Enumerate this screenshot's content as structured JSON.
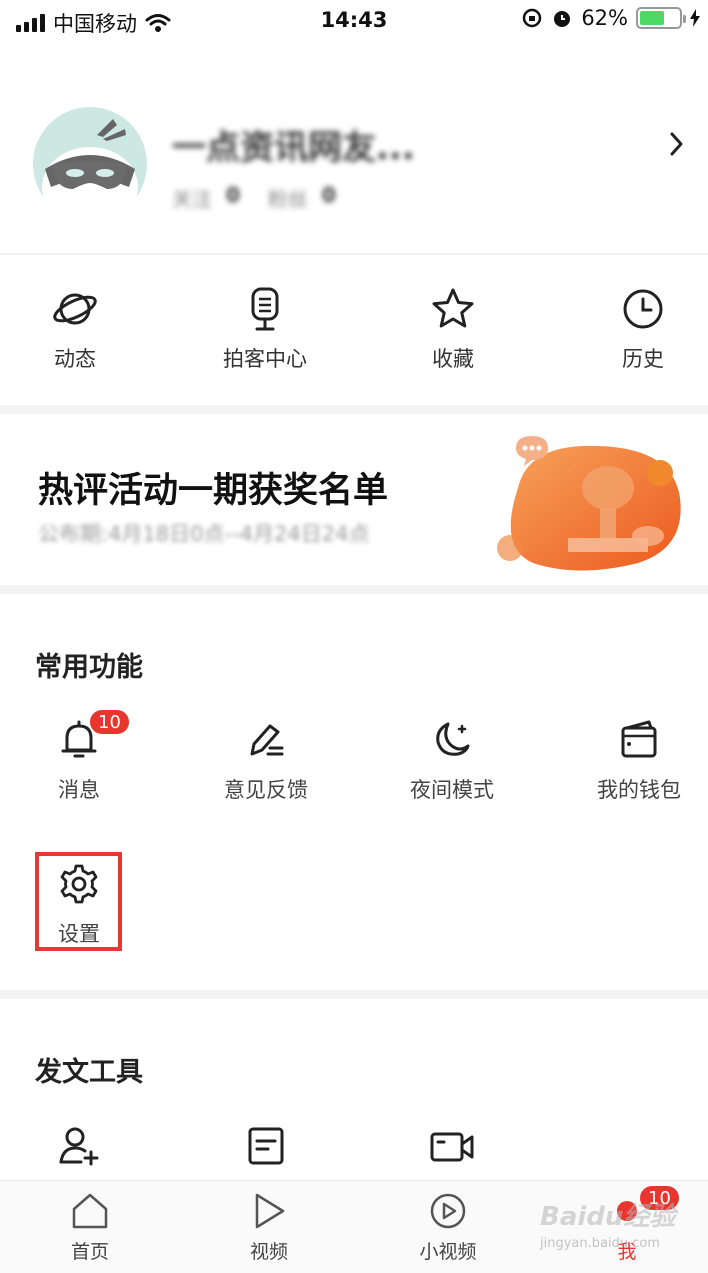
{
  "status_bar": {
    "carrier": "中国移动",
    "time": "14:43",
    "battery": "62%",
    "battery_level": 0.62
  },
  "profile": {
    "name": "一点资讯网友...",
    "following_label": "关注",
    "following_count": "0",
    "fans_label": "粉丝",
    "fans_count": "0"
  },
  "quick_actions": [
    {
      "label": "动态",
      "icon": "planet-icon"
    },
    {
      "label": "拍客中心",
      "icon": "microphone-icon"
    },
    {
      "label": "收藏",
      "icon": "star-icon"
    },
    {
      "label": "历史",
      "icon": "clock-icon"
    }
  ],
  "banner": {
    "title": "热评活动一期获奖名单",
    "subtitle": "公布期:4月18日0点--4月24日24点",
    "accent_color": "#f26b2e"
  },
  "common_functions": {
    "title": "常用功能",
    "items": [
      {
        "label": "消息",
        "icon": "bell-icon",
        "badge": "10"
      },
      {
        "label": "意见反馈",
        "icon": "pencil-icon"
      },
      {
        "label": "夜间模式",
        "icon": "moon-icon"
      },
      {
        "label": "我的钱包",
        "icon": "wallet-icon"
      },
      {
        "label": "设置",
        "icon": "gear-icon"
      }
    ]
  },
  "post_tools": {
    "title": "发文工具",
    "items": [
      {
        "icon": "add-user-icon"
      },
      {
        "icon": "article-icon"
      },
      {
        "icon": "video-camera-icon"
      }
    ]
  },
  "tabbar": {
    "items": [
      {
        "label": "首页",
        "icon": "home-icon"
      },
      {
        "label": "视频",
        "icon": "play-icon"
      },
      {
        "label": "小视频",
        "icon": "play-circle-icon"
      },
      {
        "label": "我",
        "icon": "me-icon",
        "badge": "10",
        "active": true
      }
    ]
  },
  "watermark": {
    "text": "Baidu经验",
    "url": "jingyan.baidu.com"
  },
  "colors": {
    "accent_red": "#e8362f",
    "battery_green": "#4cd964"
  }
}
